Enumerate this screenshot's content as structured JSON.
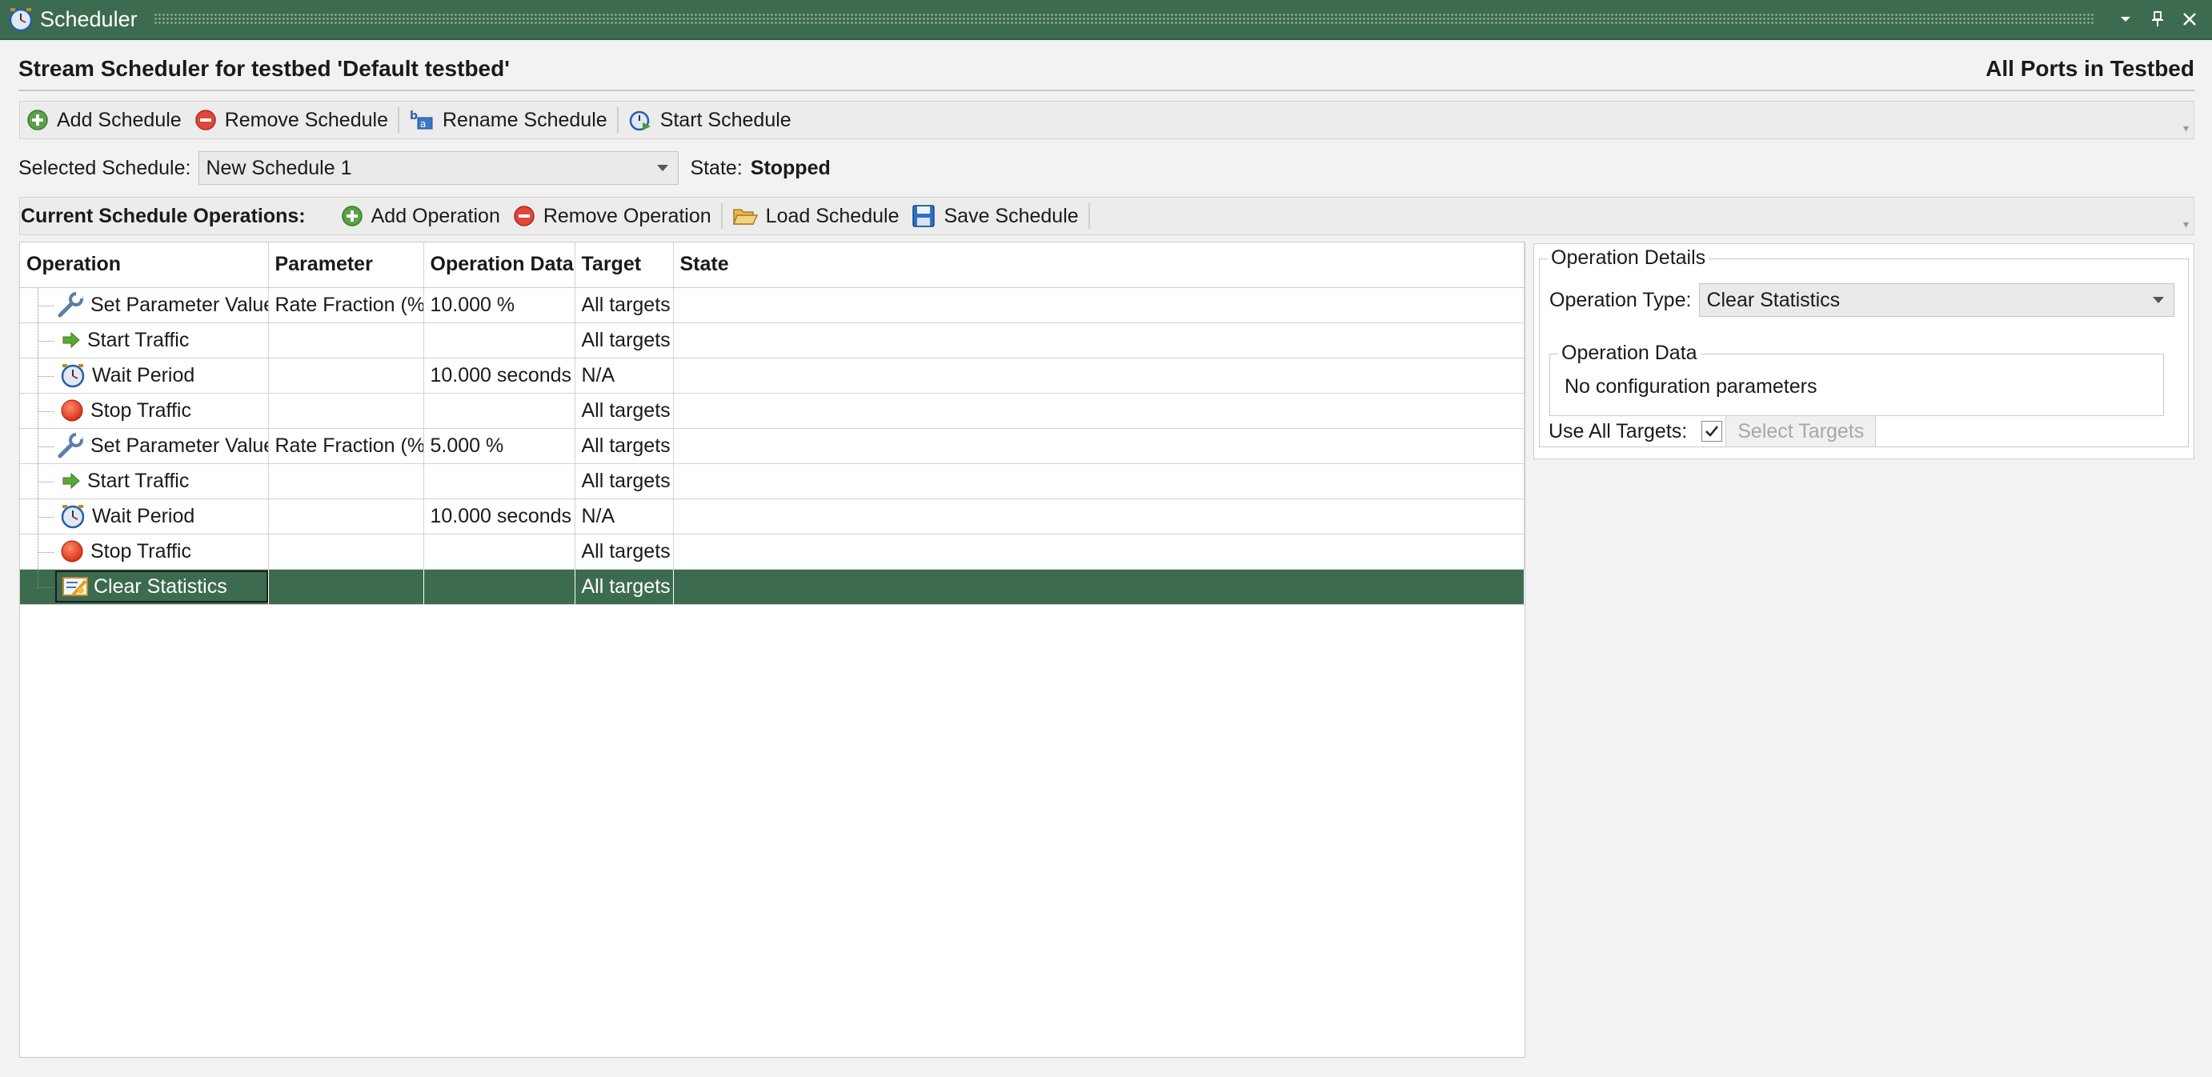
{
  "window": {
    "title": "Scheduler"
  },
  "header": {
    "title": "Stream Scheduler for testbed 'Default testbed'",
    "right_label": "All Ports in Testbed"
  },
  "schedule_toolbar": {
    "add": "Add Schedule",
    "remove": "Remove Schedule",
    "rename": "Rename Schedule",
    "start": "Start Schedule"
  },
  "schedule": {
    "selected_label": "Selected Schedule:",
    "selected_value": "New Schedule 1",
    "state_label": "State:",
    "state_value": "Stopped"
  },
  "ops_toolbar": {
    "label": "Current Schedule Operations:",
    "add": "Add Operation",
    "remove": "Remove Operation",
    "load": "Load Schedule",
    "save": "Save Schedule"
  },
  "grid": {
    "columns": [
      "Operation",
      "Parameter",
      "Operation Data",
      "Target",
      "State"
    ],
    "rows": [
      {
        "operation": "Set Parameter Value",
        "icon": "wrench-icon",
        "parameter": "Rate Fraction (%)",
        "data": "10.000 %",
        "target": "All targets",
        "state": ""
      },
      {
        "operation": "Start Traffic",
        "icon": "arrow-right-icon",
        "parameter": "",
        "data": "",
        "target": "All targets",
        "state": ""
      },
      {
        "operation": "Wait Period",
        "icon": "clock-icon",
        "parameter": "",
        "data": "10.000 seconds",
        "target": "N/A",
        "state": ""
      },
      {
        "operation": "Stop Traffic",
        "icon": "stop-icon",
        "parameter": "",
        "data": "",
        "target": "All targets",
        "state": ""
      },
      {
        "operation": "Set Parameter Value",
        "icon": "wrench-icon",
        "parameter": "Rate Fraction (%)",
        "data": "5.000 %",
        "target": "All targets",
        "state": ""
      },
      {
        "operation": "Start Traffic",
        "icon": "arrow-right-icon",
        "parameter": "",
        "data": "",
        "target": "All targets",
        "state": ""
      },
      {
        "operation": "Wait Period",
        "icon": "clock-icon",
        "parameter": "",
        "data": "10.000 seconds",
        "target": "N/A",
        "state": ""
      },
      {
        "operation": "Stop Traffic",
        "icon": "stop-icon",
        "parameter": "",
        "data": "",
        "target": "All targets",
        "state": ""
      },
      {
        "operation": "Clear Statistics",
        "icon": "clear-stats-icon",
        "parameter": "",
        "data": "",
        "target": "All targets",
        "state": ""
      }
    ]
  },
  "details": {
    "group_title": "Operation Details",
    "type_label": "Operation Type:",
    "type_value": "Clear Statistics",
    "data_group_title": "Operation Data",
    "data_text": "No configuration parameters",
    "use_all_label": "Use All Targets:",
    "select_targets": "Select Targets"
  },
  "colors": {
    "accent": "#3d6b4f",
    "selection": "#3d6b4f"
  }
}
